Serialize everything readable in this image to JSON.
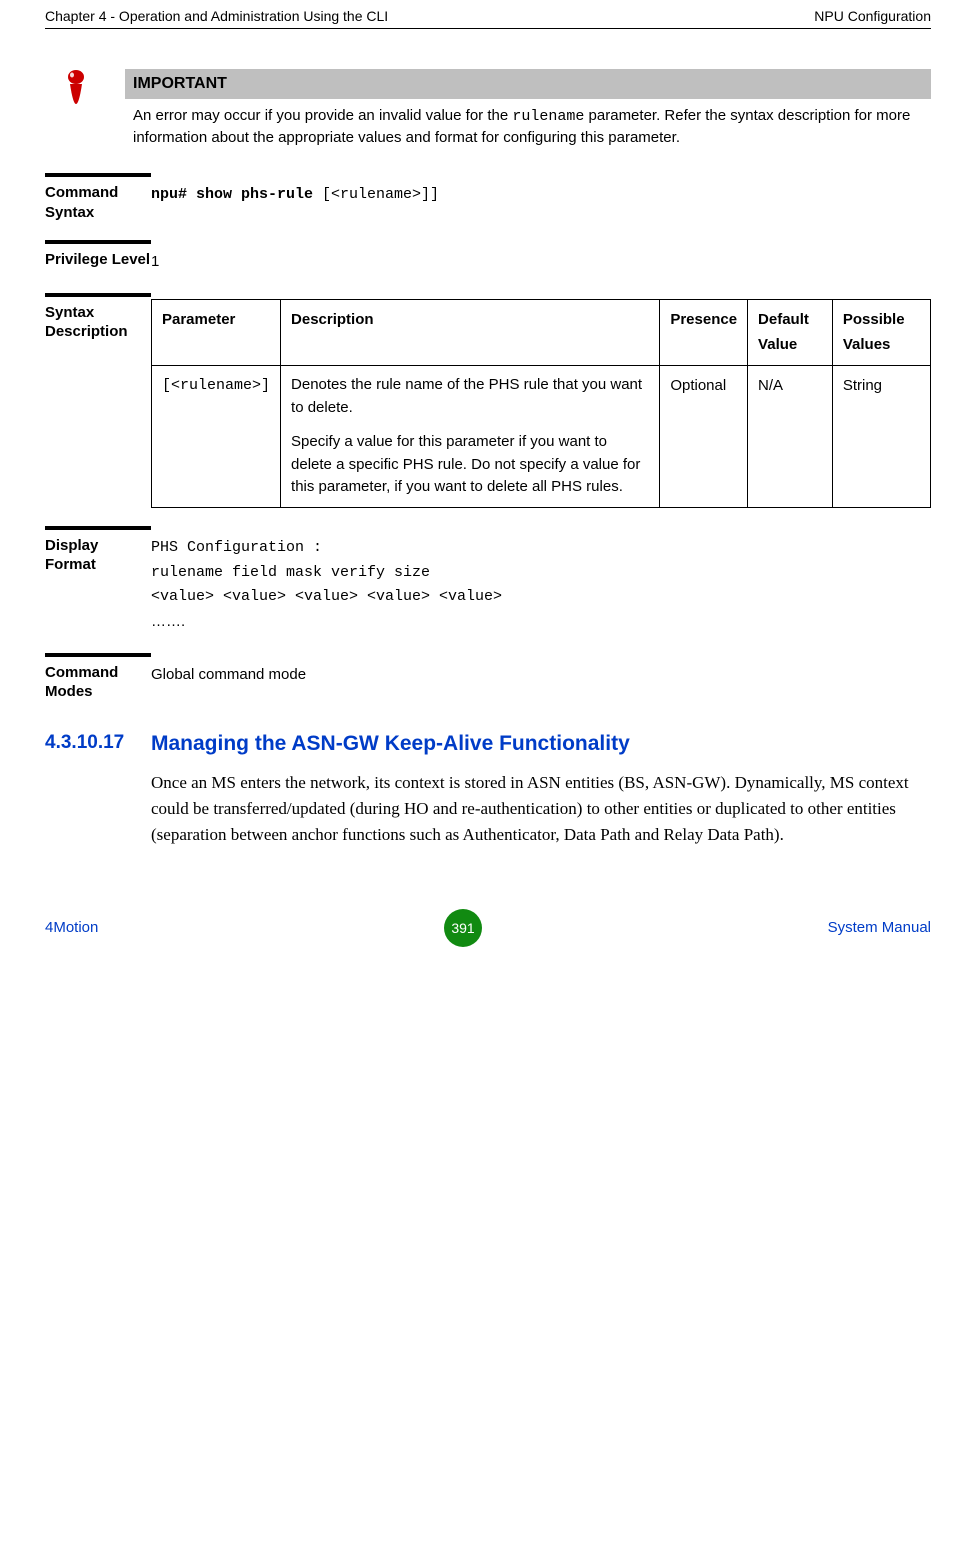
{
  "header": {
    "left": "Chapter 4 - Operation and Administration Using the CLI",
    "right": "NPU Configuration"
  },
  "important": {
    "title": "IMPORTANT",
    "text_before": "An error may occur if you provide an invalid value for the ",
    "mono_word": "rulename",
    "text_after": " parameter. Refer the syntax description for more information about the appropriate values and format for configuring this parameter."
  },
  "command_syntax": {
    "label": "Command Syntax",
    "bold_part": "npu# show phs-rule ",
    "rest": "[<rulename>]]"
  },
  "privilege": {
    "label": "Privilege Level",
    "value": "1"
  },
  "syntax_desc": {
    "label": "Syntax Description",
    "headers": {
      "param": "Parameter",
      "desc": "Description",
      "presence": "Presence",
      "default": "Default Value",
      "possible": "Possible Values"
    },
    "row": {
      "param": "[<rulename>]",
      "desc_p1": "Denotes the rule name of the PHS rule that you want to delete.",
      "desc_p2": "Specify a value for this parameter if you want to delete a specific PHS rule. Do not specify a value for this parameter, if you want to delete all PHS rules.",
      "presence": "Optional",
      "default": "N/A",
      "possible": "String"
    }
  },
  "display_format": {
    "label": "Display Format",
    "l1": "PHS Configuration :",
    "l2": "rulename field    mask   verify   size",
    "l3": "<value>  <value> <value> <value> <value>",
    "l4": "……."
  },
  "command_modes": {
    "label": "Command Modes",
    "value": "Global command mode"
  },
  "heading": {
    "num": "4.3.10.17",
    "title": "Managing the ASN-GW Keep-Alive Functionality"
  },
  "body_paragraph": "Once an MS enters the network, its context is stored in ASN entities (BS, ASN-GW). Dynamically, MS context could be transferred/updated (during HO and re-authentication) to other entities or duplicated to other entities (separation between anchor functions such as Authenticator, Data Path and Relay Data Path).",
  "footer": {
    "left": "4Motion",
    "page": "391",
    "right": "System Manual"
  }
}
